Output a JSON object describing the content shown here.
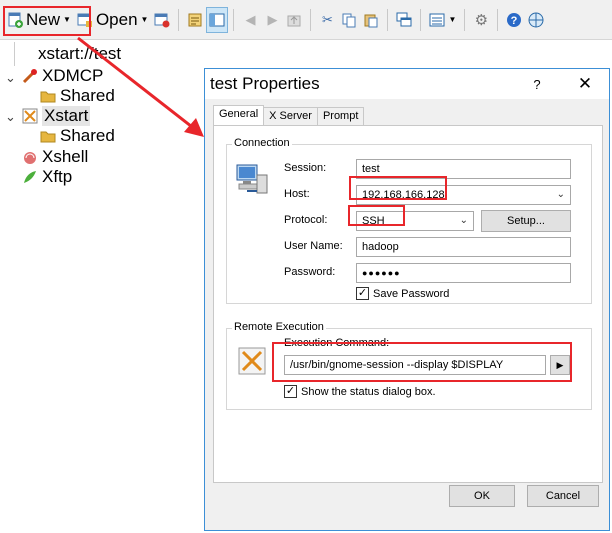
{
  "toolbar": {
    "new_label": "New",
    "open_label": "Open"
  },
  "address": {
    "value": "xstart://test"
  },
  "tree": {
    "items": [
      {
        "label": "XDMCP",
        "icon": "xdmcp-icon"
      },
      {
        "label": "Shared",
        "icon": "folder-icon"
      },
      {
        "label": "Xstart",
        "icon": "xstart-icon"
      },
      {
        "label": "Shared",
        "icon": "folder-icon"
      },
      {
        "label": "Xshell",
        "icon": "xshell-icon"
      },
      {
        "label": "Xftp",
        "icon": "xftp-icon"
      }
    ]
  },
  "dialog": {
    "title": "test Properties",
    "help": "?",
    "close": "✕",
    "tabs": [
      "General",
      "X Server",
      "Prompt"
    ],
    "connection": {
      "group_title": "Connection",
      "session_label": "Session:",
      "session_value": "test",
      "host_label": "Host:",
      "host_value": "192.168.166.128",
      "protocol_label": "Protocol:",
      "protocol_value": "SSH",
      "setup_label": "Setup...",
      "username_label": "User Name:",
      "username_value": "hadoop",
      "password_label": "Password:",
      "password_value": "●●●●●●",
      "save_password_label": "Save Password",
      "save_password_checked": true
    },
    "remote": {
      "group_title": "Remote Execution",
      "command_label": "Execution Command:",
      "command_value": "/usr/bin/gnome-session --display $DISPLAY",
      "show_status_label": "Show the status dialog box.",
      "show_status_checked": true
    },
    "ok_label": "OK",
    "cancel_label": "Cancel"
  },
  "colors": {
    "highlight": "#e8262b",
    "dialog_border": "#3c8fd6"
  }
}
